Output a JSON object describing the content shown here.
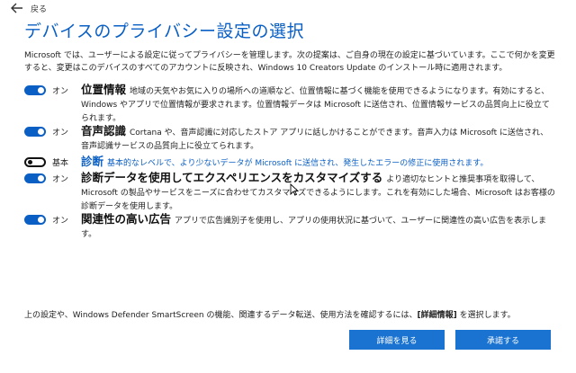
{
  "header": {
    "back_label": "戻る",
    "title": "デバイスのプライバシー設定の選択"
  },
  "intro": "Microsoft では、ユーザーによる設定に従ってプライバシーを管理します。次の提案は、ご自身の現在の設定に基づいています。ここで何かを変更すると、変更はこのデバイスのすべてのアカウントに反映され、Windows 10 Creators Update のインストール時に適用されます。",
  "options": [
    {
      "state_label": "オン",
      "on": true,
      "title": "位置情報",
      "desc": "地域の天気やお気に入りの場所への道順など、位置情報に基づく機能を使用できるようになります。有効にすると、Windows やアプリで位置情報が要求されます。位置情報データは Microsoft に送信され、位置情報サービスの品質向上に役立てられます。"
    },
    {
      "state_label": "オン",
      "on": true,
      "title": "音声認識",
      "desc": "Cortana や、音声認識に対応したストア アプリに話しかけることができます。音声入力は Microsoft に送信され、音声認識サービスの品質向上に役立てられます。"
    },
    {
      "state_label": "基本",
      "on": false,
      "title": "診断",
      "desc": "基本的なレベルで、より少ないデータが Microsoft に送信され、発生したエラーの修正に使用されます。"
    },
    {
      "state_label": "オン",
      "on": true,
      "title": "診断データを使用してエクスペリエンスをカスタマイズする",
      "desc": "より適切なヒントと推奨事項を取得して、Microsoft の製品やサービスをニーズに合わせてカスタマイズできるようにします。これを有効にした場合、Microsoft はお客様の診断データを使用します。"
    },
    {
      "state_label": "オン",
      "on": true,
      "title": "関連性の高い広告",
      "desc": "アプリで広告識別子を使用し、アプリの使用状況に基づいて、ユーザーに関連性の高い広告を表示します。"
    }
  ],
  "footer": {
    "text_before": "上の設定や、Windows Defender SmartScreen の機能、関連するデータ転送、使用方法を確認するには、",
    "link": "[詳細情報]",
    "text_after": " を選択します。"
  },
  "buttons": {
    "details": "詳細を見る",
    "accept": "承諾する"
  },
  "colors": {
    "accent": "#0a5fc4",
    "button": "#1a73d1"
  }
}
